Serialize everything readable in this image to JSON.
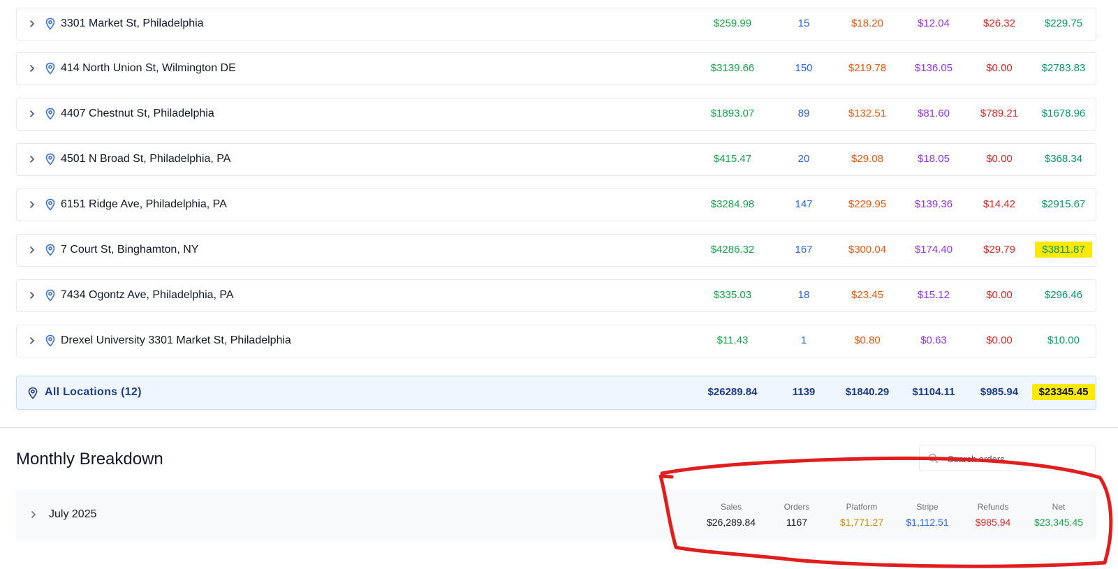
{
  "locations": [
    {
      "name": "3301 Market St, Philadelphia",
      "sales": "$259.99",
      "orders": "15",
      "platform": "$18.20",
      "stripe": "$12.04",
      "refunds": "$26.32",
      "net": "$229.75"
    },
    {
      "name": "414 North Union St, Wilmington DE",
      "sales": "$3139.66",
      "orders": "150",
      "platform": "$219.78",
      "stripe": "$136.05",
      "refunds": "$0.00",
      "net": "$2783.83"
    },
    {
      "name": "4407 Chestnut St, Philadelphia",
      "sales": "$1893.07",
      "orders": "89",
      "platform": "$132.51",
      "stripe": "$81.60",
      "refunds": "$789.21",
      "net": "$1678.96"
    },
    {
      "name": "4501 N Broad St, Philadelphia, PA",
      "sales": "$415.47",
      "orders": "20",
      "platform": "$29.08",
      "stripe": "$18.05",
      "refunds": "$0.00",
      "net": "$368.34"
    },
    {
      "name": "6151 Ridge Ave, Philadelphia, PA",
      "sales": "$3284.98",
      "orders": "147",
      "platform": "$229.95",
      "stripe": "$139.36",
      "refunds": "$14.42",
      "net": "$2915.67"
    },
    {
      "name": "7 Court St, Binghamton, NY",
      "sales": "$4286.32",
      "orders": "167",
      "platform": "$300.04",
      "stripe": "$174.40",
      "refunds": "$29.79",
      "net": "$3811.87"
    },
    {
      "name": "7434 Ogontz Ave, Philadelphia, PA",
      "sales": "$335.03",
      "orders": "18",
      "platform": "$23.45",
      "stripe": "$15.12",
      "refunds": "$0.00",
      "net": "$296.46"
    },
    {
      "name": "Drexel University 3301 Market St, Philadelphia",
      "sales": "$11.43",
      "orders": "1",
      "platform": "$0.80",
      "stripe": "$0.63",
      "refunds": "$0.00",
      "net": "$10.00"
    }
  ],
  "total": {
    "label": "All Locations (12)",
    "sales": "$26289.84",
    "orders": "1139",
    "platform": "$1840.29",
    "stripe": "$1104.11",
    "refunds": "$985.94",
    "net": "$23345.45"
  },
  "monthly": {
    "title": "Monthly Breakdown",
    "search_placeholder": "Search orders...",
    "month_label": "July 2025",
    "columns": [
      {
        "header": "Sales",
        "value": "$26,289.84",
        "color": "#111827"
      },
      {
        "header": "Orders",
        "value": "1167",
        "color": "#111827"
      },
      {
        "header": "Platform",
        "value": "$1,771.27",
        "color": "#ca8a04"
      },
      {
        "header": "Stripe",
        "value": "$1,112.51",
        "color": "#2563eb"
      },
      {
        "header": "Refunds",
        "value": "$985.94",
        "color": "#dc2626"
      },
      {
        "header": "Net",
        "value": "$23,345.45",
        "color": "#16a34a"
      }
    ]
  },
  "colors": {
    "highlight": "#fde905",
    "annotation": "#e11d1d",
    "pin": "#3b6fd8"
  }
}
